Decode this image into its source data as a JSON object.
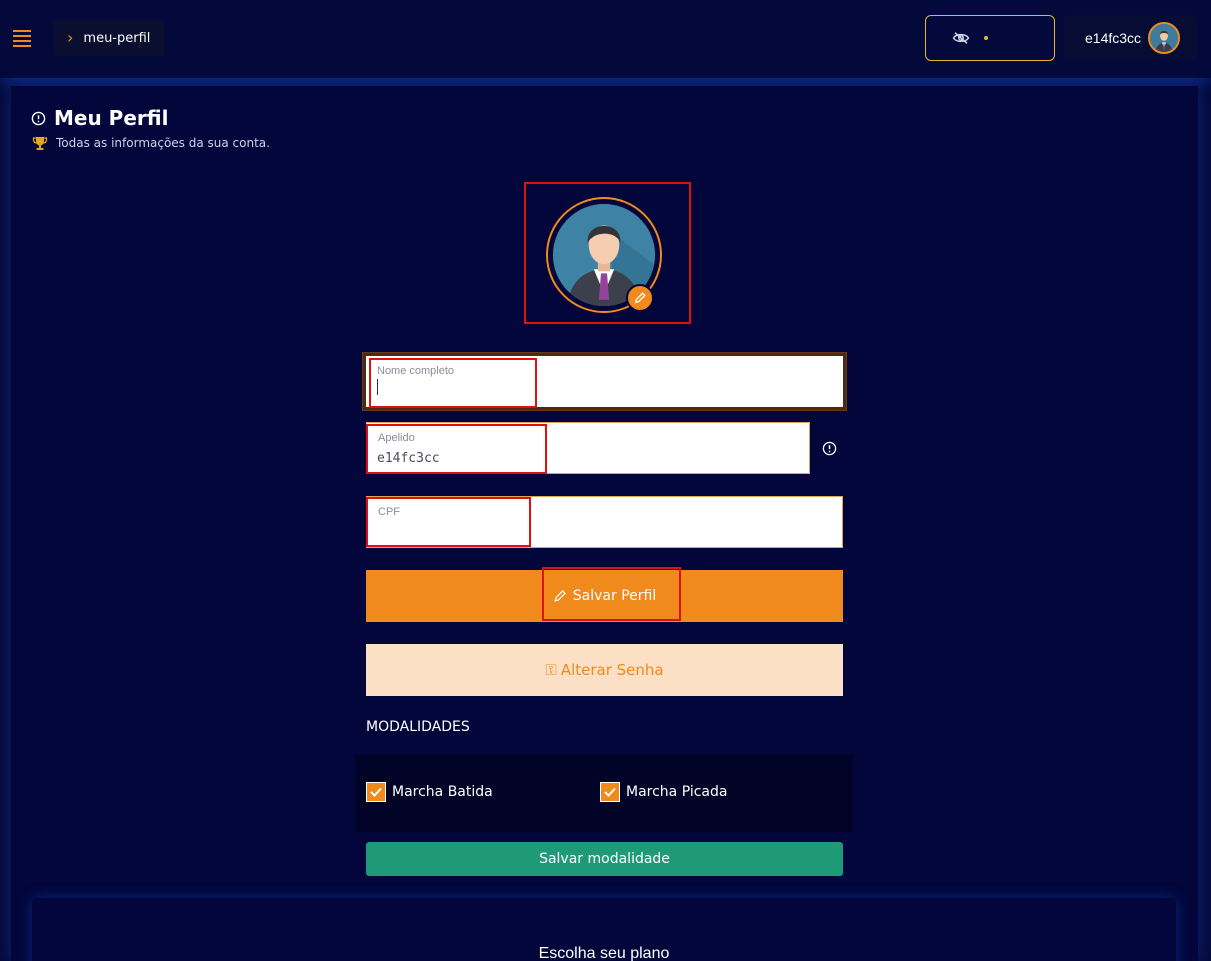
{
  "header": {
    "breadcrumb": "meu-perfil",
    "username": "e14fc3cc"
  },
  "page": {
    "title": "Meu Perfil",
    "subtitle": "Todas as informações da sua conta."
  },
  "form": {
    "nome_label": "Nome completo",
    "nome_value": "",
    "apelido_label": "Apelido",
    "apelido_value": "e14fc3cc",
    "cpf_label": "CPF",
    "cpf_value": ""
  },
  "buttons": {
    "save_profile": "Salvar Perfil",
    "change_password": "Alterar Senha",
    "save_modality": "Salvar modalidade"
  },
  "modalidades": {
    "title": "MODALIDADES",
    "items": [
      {
        "label": "Marcha Batida",
        "checked": true
      },
      {
        "label": "Marcha Picada",
        "checked": true
      }
    ]
  },
  "plans": {
    "title": "Escolha seu plano"
  },
  "colors": {
    "accent": "#f08a1c",
    "background": "#050a3a",
    "success": "#1f9a78",
    "highlight": "#e01010"
  }
}
